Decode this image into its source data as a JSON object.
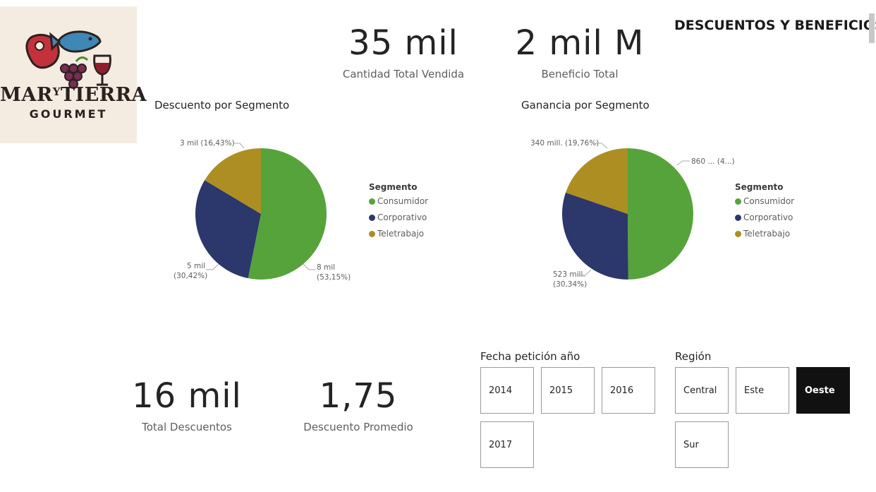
{
  "logo": {
    "line1a": "MAR",
    "line1b": "Y",
    "line1c": "TIERRA",
    "line2": "GOURMET"
  },
  "page_title": "DESCUENTOS Y BENEFICIOS",
  "kpis": {
    "cantidad": {
      "value": "35 mil",
      "label": "Cantidad Total Vendida"
    },
    "beneficio": {
      "value": "2 mil M",
      "label": "Beneficio Total"
    },
    "descuentos": {
      "value": "16 mil",
      "label": "Total Descuentos"
    },
    "promedio": {
      "value": "1,75",
      "label": "Descuento Promedio"
    }
  },
  "colors": {
    "consumidor": "#56a33b",
    "corporativo": "#2c376b",
    "teletrabajo": "#ad8e22"
  },
  "legend": {
    "title": "Segmento",
    "items": [
      "Consumidor",
      "Corporativo",
      "Teletrabajo"
    ]
  },
  "chart_data": [
    {
      "type": "pie",
      "title": "Descuento por Segmento",
      "legend_title": "Segmento",
      "categories": [
        "Consumidor",
        "Corporativo",
        "Teletrabajo"
      ],
      "values": [
        53.15,
        30.42,
        16.43
      ],
      "labels": {
        "consumidor": [
          "8 mil",
          "(53,15%)"
        ],
        "corporativo": [
          "5 mil",
          "(30,42%)"
        ],
        "teletrabajo": [
          "3 mil (16,43%)"
        ]
      }
    },
    {
      "type": "pie",
      "title": "Ganancia por Segmento",
      "legend_title": "Segmento",
      "categories": [
        "Consumidor",
        "Corporativo",
        "Teletrabajo"
      ],
      "values": [
        49.9,
        30.34,
        19.76
      ],
      "labels": {
        "consumidor": [
          "860 ... (4...)"
        ],
        "corporativo": [
          "523 mill.",
          "(30,34%)"
        ],
        "teletrabajo": [
          "340 mill. (19,76%)"
        ]
      }
    }
  ],
  "slicer_year": {
    "title": "Fecha petición año",
    "options": [
      "2014",
      "2015",
      "2016",
      "2017"
    ]
  },
  "slicer_region": {
    "title": "Región",
    "options": [
      "Central",
      "Este",
      "Oeste",
      "Sur"
    ],
    "selected": "Oeste"
  }
}
